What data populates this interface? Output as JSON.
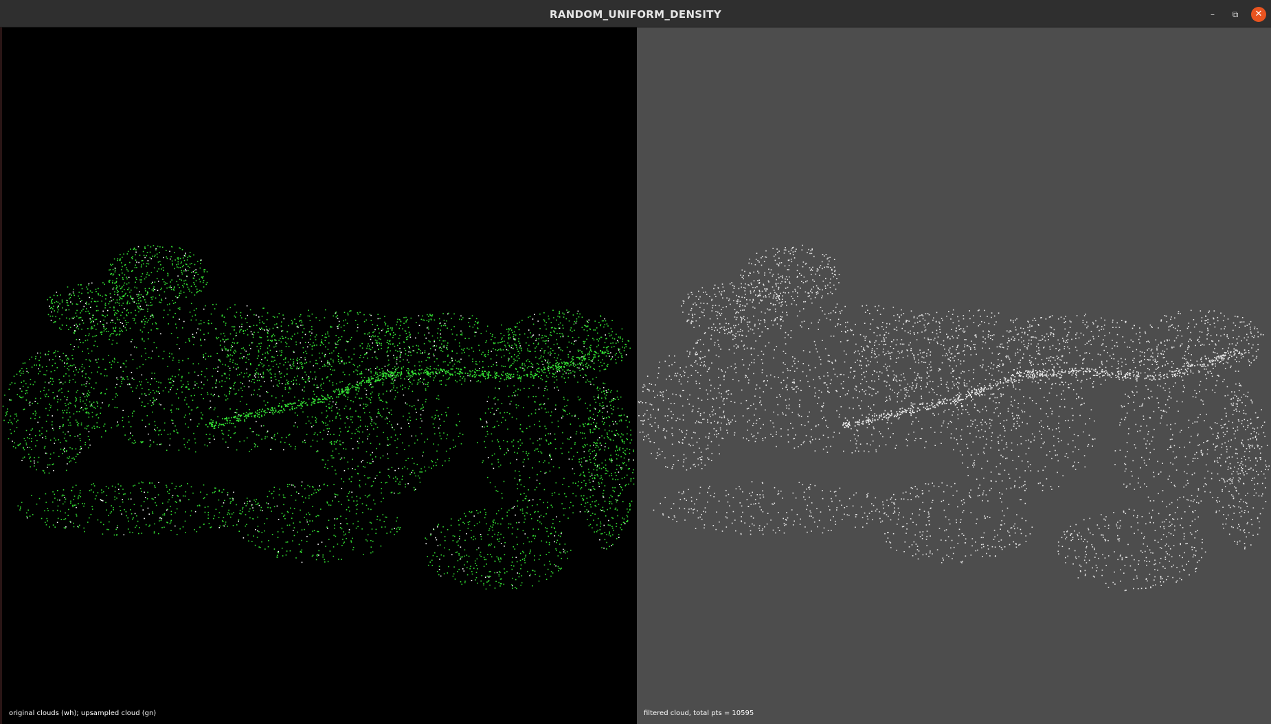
{
  "window": {
    "title": "RANDOM_UNIFORM_DENSITY",
    "controls": {
      "minimize": "–",
      "maximize": "⧉",
      "close": "✕"
    }
  },
  "viewports": {
    "left": {
      "caption": "original clouds (wh); upsampled cloud (gn)",
      "background": "#000000",
      "point_color_primary": "#33e033",
      "point_color_secondary": "#ffffff"
    },
    "right": {
      "caption": "filtered cloud, total pts = 10595",
      "background": "#4d4d4d",
      "point_color": "#e8e8e8"
    }
  }
}
